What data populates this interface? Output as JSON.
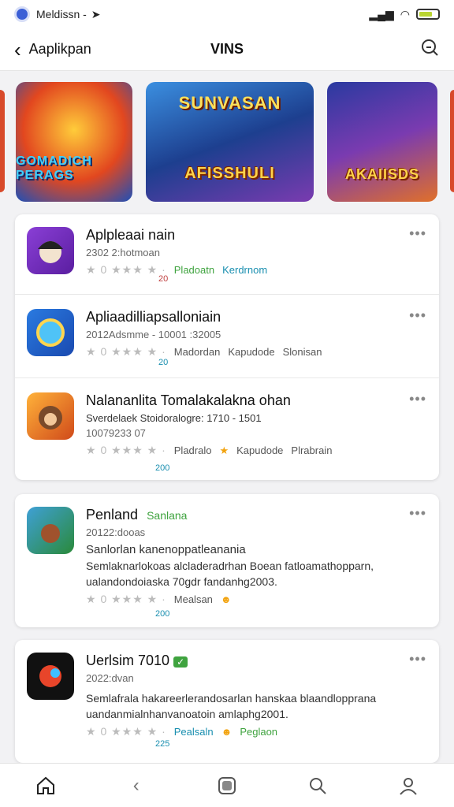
{
  "status": {
    "carrier": "Meldissn -"
  },
  "header": {
    "back_label": "Aaplikpan",
    "center_title": "VINS"
  },
  "banners": [
    {
      "title": "",
      "label": "GOMADICH PERAGS",
      "bg": "#e2471f"
    },
    {
      "title": "SUNVASAN",
      "label": "AFISSHULI",
      "bg": "#2b6cc4"
    },
    {
      "title": "",
      "label": "AKAIISDS",
      "bg": "#5a3aa8"
    }
  ],
  "card1": [
    {
      "name": "Aplpleaai nain",
      "meta": "2302 2:hotmoan",
      "rating_text": "Pladoatn",
      "extra": "Kerdrnom",
      "sub": "20"
    },
    {
      "name": "Apliaadilliapsalloniain",
      "meta": "2012Adsmme - 10001 :32005",
      "rating_text": "Madordan",
      "extra": "Kapudode",
      "extra2": "Slonisan",
      "sub": "20"
    },
    {
      "name": "Nalananlita Tomalakalakna ohan",
      "meta": "Sverdelaek Stoidoralogre: 1710 - 1501",
      "meta2": "10079233 07",
      "rating_text": "Pladralo",
      "extra": "Kapudode",
      "extra2": "Plrabrain",
      "sub": "200"
    }
  ],
  "card2": {
    "name": "Penland",
    "tag": "Sanlana",
    "meta": "20122:dooas",
    "desc1": "Sanlorlan kanenoppatleanania",
    "desc2": "Semlaknarlokoas alcladeradrhan Boean fatloamathopparn,",
    "desc3": "ualandondoiaska 70gdr fandanhg2003.",
    "rating_text": "Mealsan",
    "sub": "200"
  },
  "card3": {
    "name": "Uerlsim 7010",
    "meta": "2022:dvan",
    "desc1": "Semlafrala hakareerlerandosarlan hanskaa blaandlopprana",
    "desc2": "uandanmialnhanvanoatoin amlaphg2001.",
    "rating_text": "Pealsaln",
    "extra": "Peglaon",
    "sub": "225"
  },
  "colors": {
    "accent": "#1a8fb0",
    "green": "#3fa33f",
    "star": "#f2a30f"
  }
}
